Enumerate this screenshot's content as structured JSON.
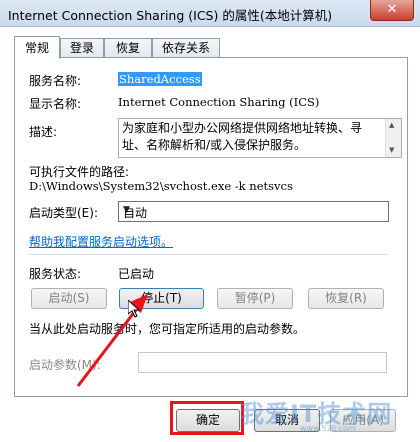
{
  "window": {
    "title": "Internet Connection Sharing (ICS) 的属性(本地计算机)",
    "close_label": "✕"
  },
  "tabs": [
    {
      "label": "常规"
    },
    {
      "label": "登录"
    },
    {
      "label": "恢复"
    },
    {
      "label": "依存关系"
    }
  ],
  "general": {
    "service_name_label": "服务名称:",
    "service_name_value": "SharedAccess",
    "display_name_label": "显示名称:",
    "display_name_value": "Internet Connection Sharing (ICS)",
    "description_label": "描述:",
    "description_value": "为家庭和小型办公网络提供网络地址转换、寻址、名称解析和/或入侵保护服务。",
    "exe_path_label": "可执行文件的路径:",
    "exe_path_value": "D:\\Windows\\System32\\svchost.exe -k netsvcs",
    "startup_type_label": "启动类型(E):",
    "startup_type_value": "自动",
    "help_link": "帮助我配置服务启动选项。",
    "status_label": "服务状态:",
    "status_value": "已启动",
    "buttons": {
      "start": "启动(S)",
      "stop": "停止(T)",
      "pause": "暂停(P)",
      "resume": "恢复(R)"
    },
    "hint": "当从此处启动服务时，您可指定所适用的启动参数。",
    "params_label": "启动参数(M):",
    "params_value": ""
  },
  "footer": {
    "ok": "确定",
    "cancel": "取消",
    "apply": "应用(A)"
  },
  "watermark": {
    "main": "我爱IT技术网",
    "sub": "www.52ij.com"
  },
  "colors": {
    "annotation_red": "#e8141c",
    "link": "#0066cc",
    "selection": "#3399ff"
  }
}
